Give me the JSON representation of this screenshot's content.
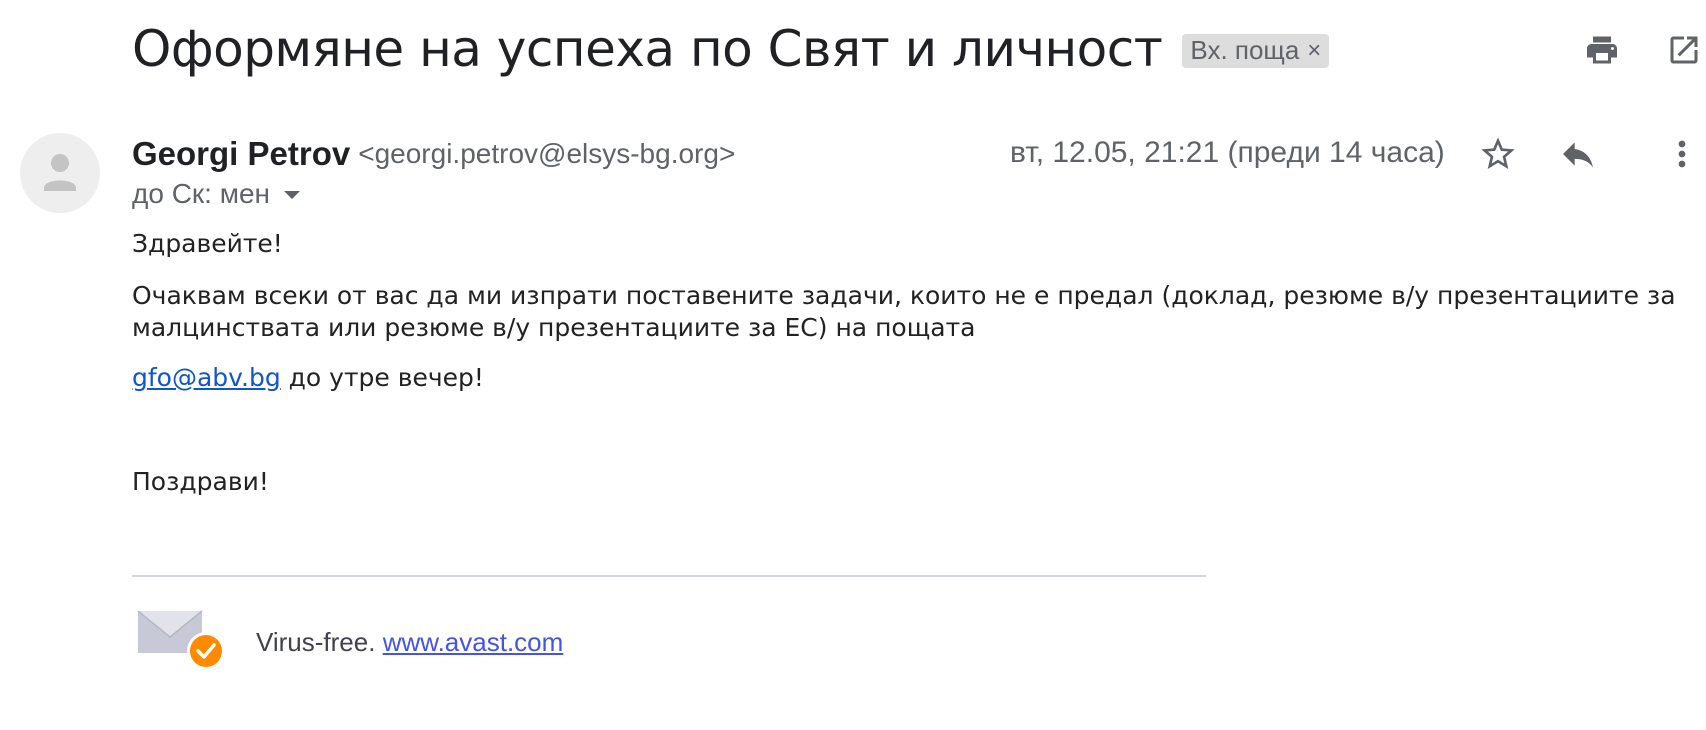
{
  "subject": {
    "title": "Оформяне на успеха по Свят и личност",
    "label": "Вх. поща",
    "label_close": "×"
  },
  "top_actions": {
    "print_icon": "print-icon",
    "new_window_icon": "open-in-new-window-icon"
  },
  "message": {
    "sender_name": "Georgi Petrov",
    "sender_email": "<georgi.petrov@elsys-bg.org>",
    "date": "вт, 12.05, 21:21 (преди 14 часа)",
    "recipients": "до Ск: мен",
    "actions": {
      "star_icon": "star-icon",
      "reply_icon": "reply-icon",
      "more_icon": "more-vertical-icon"
    }
  },
  "body": {
    "greeting": "Здравейте!",
    "main_text": "Очаквам всеки от вас да  ми изпрати поставените задачи, които не е предал (доклад, резюме в/у презентациите за малцинствата или резюме в/у презентациите за ЕС) на пощата",
    "email_link": "gfo@abv.bg",
    "after_link": " до утре вечер!",
    "closing": "Поздрави!"
  },
  "signature": {
    "virus_free_text": "Virus-free. ",
    "avast_link": "www.avast.com"
  },
  "colors": {
    "link": "#1155cc",
    "avast_link": "#4453ea",
    "avast_badge": "#ff8a00",
    "chip_bg": "#dddddd",
    "secondary_text": "#5f6368"
  }
}
